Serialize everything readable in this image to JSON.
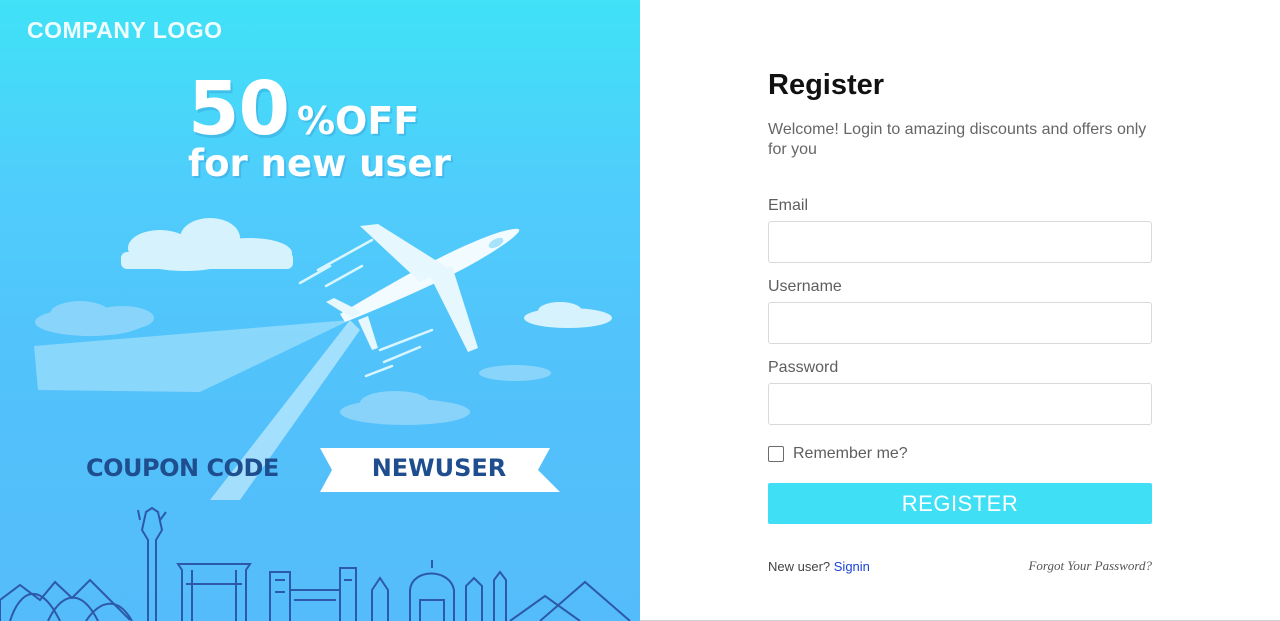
{
  "banner": {
    "company_logo": "COMPANY LOGO",
    "promo_number": "50",
    "promo_percent": "%OFF",
    "promo_subtitle": "for new user",
    "coupon_label": "COUPON CODE",
    "coupon_code": "NEWUSER"
  },
  "form": {
    "title": "Register",
    "subtitle": "Welcome! Login to amazing discounts and offers only for you",
    "email_label": "Email",
    "email_value": "",
    "username_label": "Username",
    "username_value": "",
    "password_label": "Password",
    "password_value": "",
    "remember_label": "Remember me?",
    "remember_checked": false,
    "register_button": "REGISTER"
  },
  "footer": {
    "new_user_text": "New user?",
    "signin_link": "Signin",
    "forgot_link": "Forgot Your Password?"
  },
  "colors": {
    "accent": "#3fe0f6",
    "link": "#1a44d6",
    "coupon_text": "#1f4e8f"
  },
  "icons": [
    "airplane-illustration",
    "cloud-shape",
    "city-skyline-illustration",
    "checkbox-empty"
  ]
}
